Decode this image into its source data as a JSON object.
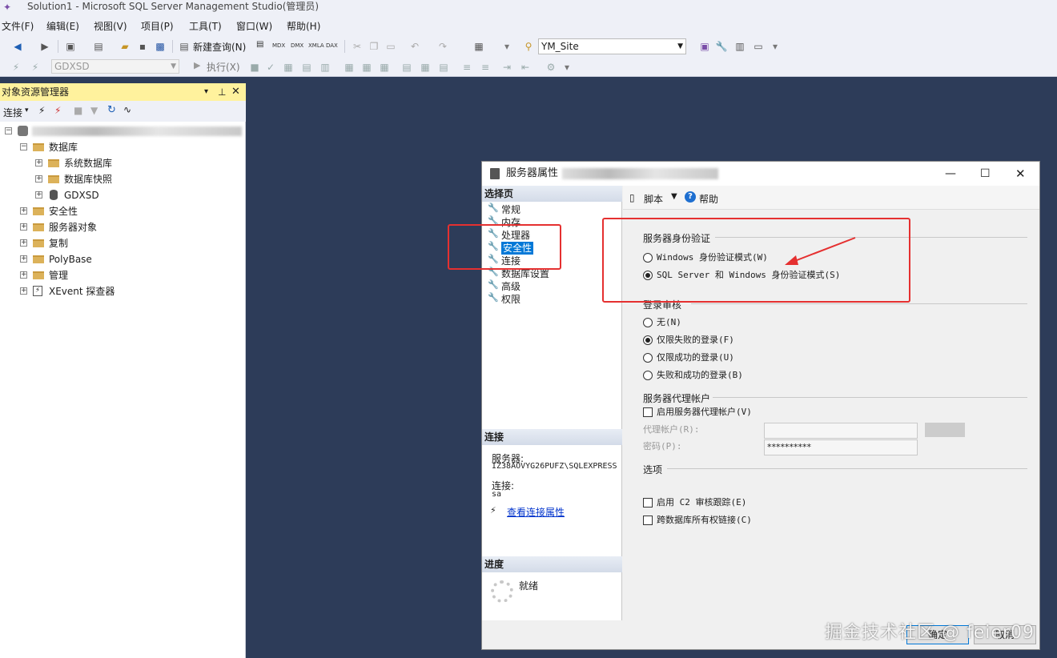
{
  "app": {
    "title": "Solution1 - Microsoft SQL Server Management Studio(管理员)"
  },
  "menu": [
    "文件(F)",
    "编辑(E)",
    "视图(V)",
    "项目(P)",
    "工具(T)",
    "窗口(W)",
    "帮助(H)"
  ],
  "toolbar": {
    "new_query": "新建查询(N)",
    "mdx": "MDX",
    "dmx": "DMX",
    "xmla": "XMLA",
    "dax": "DAX",
    "db_selector": "YM_Site",
    "db_selector2": "GDXSD",
    "execute": "执行(X)"
  },
  "explorer": {
    "title": "对象资源管理器",
    "connect": "连接",
    "tree": {
      "databases": "数据库",
      "system_databases": "系统数据库",
      "db_snapshots": "数据库快照",
      "gdxsd": "GDXSD",
      "security": "安全性",
      "server_objects": "服务器对象",
      "replication": "复制",
      "polybase": "PolyBase",
      "management": "管理",
      "xevent": "XEvent 探查器"
    }
  },
  "dialog": {
    "title": "服务器属性",
    "select_page": "选择页",
    "pages": [
      "常规",
      "内存",
      "处理器",
      "安全性",
      "连接",
      "数据库设置",
      "高级",
      "权限"
    ],
    "selected_page": "安全性",
    "script_btn": "脚本",
    "help_btn": "帮助",
    "connection_head": "连接",
    "server_label": "服务器:",
    "server_value": "IZ38AOVYG26PUFZ\\SQLEXPRESS",
    "conn_label": "连接:",
    "conn_value": "sa",
    "view_conn_props": "查看连接属性",
    "progress_head": "进度",
    "progress_status": "就绪",
    "auth_group": "服务器身份验证",
    "auth_windows": "Windows 身份验证模式(W)",
    "auth_mixed": "SQL Server 和 Windows 身份验证模式(S)",
    "auth_selected": "mixed",
    "audit_group": "登录审核",
    "audit_none": "无(N)",
    "audit_failed": "仅限失败的登录(F)",
    "audit_success": "仅限成功的登录(U)",
    "audit_both": "失败和成功的登录(B)",
    "audit_selected": "failed",
    "proxy_group": "服务器代理帐户",
    "proxy_enable": "启用服务器代理帐户(V)",
    "proxy_account": "代理帐户(R):",
    "proxy_password": "密码(P):",
    "proxy_password_value": "**********",
    "options_group": "选项",
    "c2_audit": "启用 C2 审核跟踪(E)",
    "cross_db": "跨数据库所有权链接(C)",
    "ok": "确定",
    "cancel": "取消"
  },
  "watermark": "掘金技术社区 @ feier09",
  "colors": {
    "highlight": "#0078d7",
    "annotation_red": "#e53030",
    "workspace": "#2d3c59",
    "explorer_header": "#fff29d"
  }
}
